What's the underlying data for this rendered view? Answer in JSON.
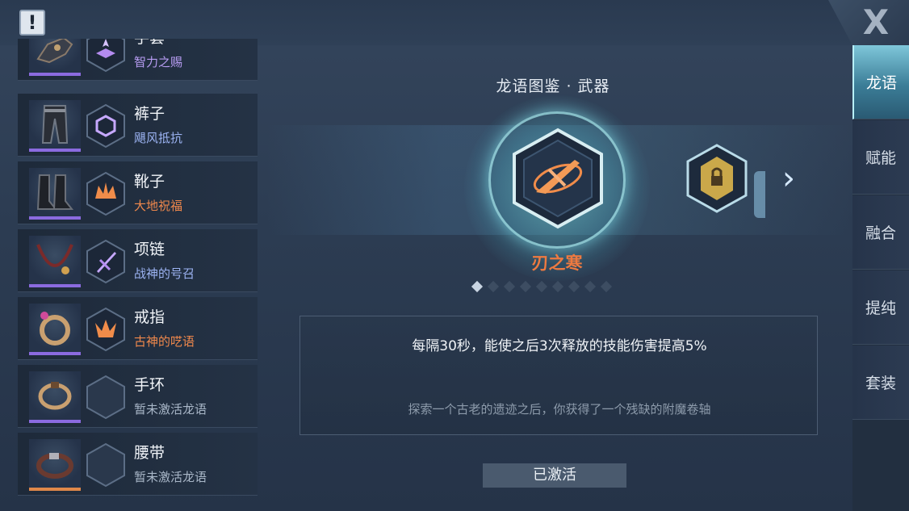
{
  "header": {
    "alert_icon": "!",
    "close_icon": "X"
  },
  "equipment": [
    {
      "name": "手套",
      "rune": "智力之赐",
      "rune_color": "purple",
      "rarity": "purple",
      "icon": "gauntlet-icon",
      "rune_icon": "book-rune-icon",
      "active": true
    },
    {
      "name": "裤子",
      "rune": "飓风抵抗",
      "rune_color": "blue",
      "rarity": "purple",
      "icon": "pants-icon",
      "rune_icon": "cube-rune-icon",
      "active": true
    },
    {
      "name": "靴子",
      "rune": "大地祝福",
      "rune_color": "orange",
      "rarity": "purple",
      "icon": "boots-icon",
      "rune_icon": "crown-rune-icon",
      "active": true
    },
    {
      "name": "项链",
      "rune": "战神的号召",
      "rune_color": "blue",
      "rarity": "purple",
      "icon": "necklace-icon",
      "rune_icon": "sword-rune-icon",
      "active": true
    },
    {
      "name": "戒指",
      "rune": "古神的呓语",
      "rune_color": "orange",
      "rarity": "purple",
      "icon": "ring-icon",
      "rune_icon": "claw-rune-icon",
      "active": true
    },
    {
      "name": "手环",
      "rune": "暂未激活龙语",
      "rune_color": "gray",
      "rarity": "purple",
      "icon": "bracelet-icon",
      "rune_icon": "empty-rune-slot",
      "active": false
    },
    {
      "name": "腰带",
      "rune": "暂未激活龙语",
      "rune_color": "gray",
      "rarity": "orange",
      "icon": "belt-icon",
      "rune_icon": "empty-rune-slot",
      "active": false
    }
  ],
  "codex": {
    "title": "龙语图鉴 · 武器",
    "weapon_name": "刃之寒",
    "page_count": 9,
    "current_page": 1,
    "next_icon": "chevron-right-icon",
    "description": "每隔30秒，能使之后3次释放的技能伤害提高5%",
    "lore": "探索一个古老的遗迹之后，你获得了一个残缺的附魔卷轴",
    "status_label": "已激活"
  },
  "tabs": [
    {
      "label": "龙语",
      "active": true
    },
    {
      "label": "赋能",
      "active": false
    },
    {
      "label": "融合",
      "active": false
    },
    {
      "label": "提纯",
      "active": false
    },
    {
      "label": "套装",
      "active": false
    }
  ],
  "colors": {
    "accent_orange": "#ee7a40",
    "accent_purple": "#b79cf2",
    "active_tab": "#7fc7da"
  }
}
